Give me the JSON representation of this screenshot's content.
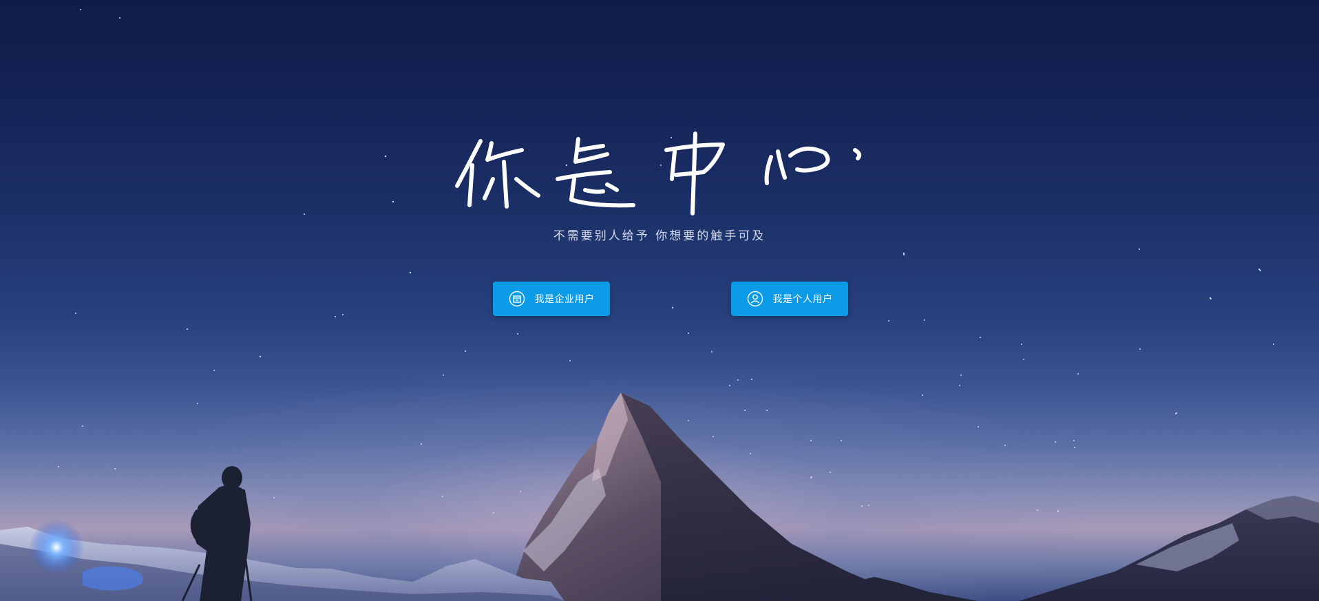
{
  "hero": {
    "title": "你是中心",
    "slogan": "不需要别人给予  你想要的触手可及"
  },
  "buttons": {
    "enterprise": {
      "label": "我是企业用户",
      "icon": "building-icon"
    },
    "personal": {
      "label": "我是个人用户",
      "icon": "user-icon"
    }
  },
  "colors": {
    "button_bg": "#0c9be6",
    "sky_top": "#101b48",
    "sky_horizon": "#a89ab8",
    "text": "#ffffff"
  }
}
